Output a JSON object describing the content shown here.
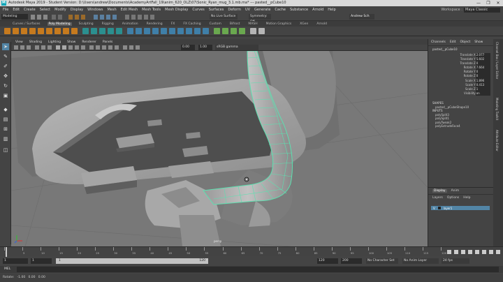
{
  "window": {
    "title": "Autodesk Maya 2019 - Student Version: D:\\Users\\andrew\\Documents\\AcademyArtFall_19\\anim_620_OLZ\\07\\Sonic_Ryan_mug_3.1.mb.ma* --- pasted__pCube10",
    "controls": [
      "—",
      "❐",
      "✕"
    ]
  },
  "menubar": {
    "items": [
      "File",
      "Edit",
      "Create",
      "Select",
      "Modify",
      "Display",
      "Windows",
      "Mesh",
      "Edit Mesh",
      "Mesh Tools",
      "Mesh Display",
      "Curves",
      "Surfaces",
      "Deform",
      "UV",
      "Generate",
      "Cache",
      "Substance",
      "Arnold",
      "Help"
    ],
    "workspace_label": "Workspace :",
    "workspace_value": "Maya Classic"
  },
  "statusline": {
    "mode": "Modeling",
    "live_surface": "No Live Surface",
    "symmetry": "Symmetry: Off",
    "user": "Andrew Sch"
  },
  "shelf": {
    "tabs": [
      "Curves / Surfaces",
      "Poly Modeling",
      "Sculpting",
      "Rigging",
      "Animation",
      "Rendering",
      "FX",
      "FX Caching",
      "Custom",
      "Bifrost",
      "MASH",
      "Motion Graphics",
      "XGen",
      "Arnold"
    ],
    "active_tab": "Poly Modeling"
  },
  "viewport": {
    "menu": [
      "View",
      "Shading",
      "Lighting",
      "Show",
      "Renderer",
      "Panels"
    ],
    "field_1": "0.00",
    "field_2": "1.00",
    "colorspace": "sRGB gamma",
    "camera": "persp"
  },
  "channelbox": {
    "tabs": [
      "Channels",
      "Edit",
      "Object",
      "Show"
    ],
    "object_name": "pasted__pCube10",
    "channels": [
      {
        "name": "Translate X",
        "value": "2.077"
      },
      {
        "name": "Translate Y",
        "value": "5.602"
      },
      {
        "name": "Translate Z",
        "value": "0"
      },
      {
        "name": "Rotate X",
        "value": "7.664"
      },
      {
        "name": "Rotate Y",
        "value": "0"
      },
      {
        "name": "Rotate Z",
        "value": "0"
      },
      {
        "name": "Scale X",
        "value": "1.896"
      },
      {
        "name": "Scale Y",
        "value": "0.413"
      },
      {
        "name": "Scale Z",
        "value": "1"
      },
      {
        "name": "Visibility",
        "value": "on"
      }
    ],
    "shapes_header": "SHAPES",
    "shape_name": "pasted__pCubeShape10",
    "inputs_header": "INPUTS",
    "inputs": [
      "polySplit3",
      "polySplit1",
      "polyTweak2",
      "polyExtrudeFace4"
    ]
  },
  "sidetabs": [
    "Channel Box / Layer Editor",
    "Modeling Toolkit",
    "Attribute Editor"
  ],
  "layers": {
    "tabs": [
      "Display",
      "Anim"
    ],
    "menu": [
      "Layers",
      "Options",
      "Help"
    ],
    "layer_vis": "V",
    "layer_name": "layer1"
  },
  "timeline": {
    "ticks": [
      "1",
      "5",
      "10",
      "15",
      "20",
      "25",
      "30",
      "35",
      "40",
      "45",
      "50",
      "55",
      "60",
      "65",
      "70",
      "75",
      "80",
      "85",
      "90",
      "95",
      "100",
      "105",
      "110",
      "115",
      "120"
    ],
    "current_frame": "1"
  },
  "range": {
    "start": "1",
    "start_inner": "1",
    "slider_start": "1",
    "slider_end": "120",
    "end_inner": "120",
    "end": "200",
    "character_set": "No Character Set",
    "anim_layer": "No Anim Layer",
    "fps": "24 fps"
  },
  "cmdline": {
    "label": "MEL"
  },
  "helpline": {
    "text": "Rotate:   -1.00   0.00   0.00"
  },
  "colors": {
    "highlight": "#5de0b0",
    "accent": "#5285a6",
    "viewport_bg": "#787878"
  }
}
